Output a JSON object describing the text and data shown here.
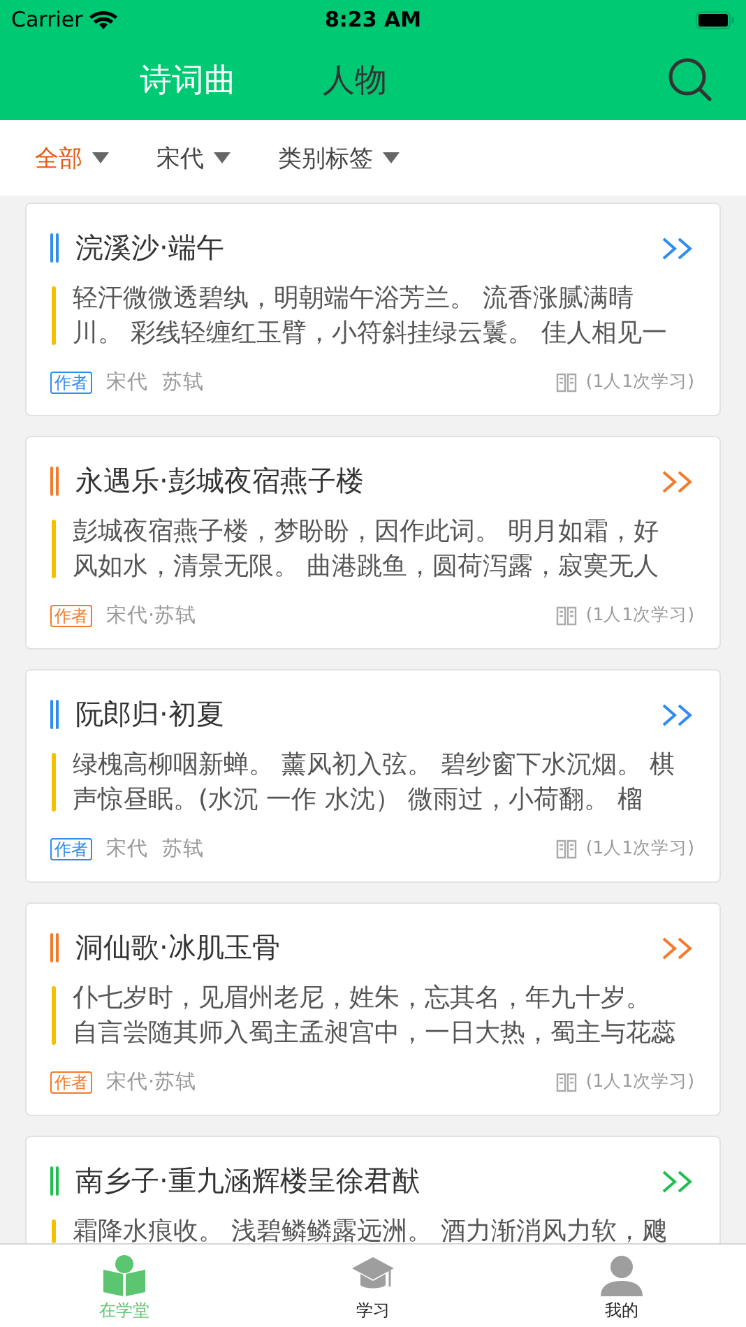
{
  "status_bar": {
    "carrier": "Carrier",
    "time": "8:23 AM"
  },
  "top_tabs": [
    {
      "label": "诗词曲",
      "selected": true
    },
    {
      "label": "人物",
      "selected": false
    }
  ],
  "filters": [
    {
      "label": "全部",
      "selected": true
    },
    {
      "label": "宋代",
      "selected": false
    },
    {
      "label": "类别标签",
      "selected": false
    }
  ],
  "cards": [
    {
      "title": "浣溪沙·端午",
      "color": "#2f8cf0",
      "lines": [
        "轻汗微微透碧纨，明朝端午浴芳兰。 流香涨腻满晴",
        "川。 彩线轻缠红玉臂，小符斜挂绿云鬟。 佳人相见一"
      ],
      "tag": "作者",
      "meta": [
        "宋代",
        "苏轼"
      ],
      "stats": "(1人1次学习)"
    },
    {
      "title": "永遇乐·彭城夜宿燕子楼",
      "color": "#f47a2a",
      "lines": [
        "彭城夜宿燕子楼，梦盼盼，因作此词。 明月如霜，好",
        "风如水，清景无限。 曲港跳鱼，圆荷泻露，寂寞无人"
      ],
      "tag": "作者",
      "meta": [
        "宋代·苏轼"
      ],
      "stats": "(1人1次学习)"
    },
    {
      "title": "阮郎归·初夏",
      "color": "#2f8cf0",
      "lines": [
        "绿槐高柳咽新蝉。 薰风初入弦。 碧纱窗下水沉烟。 棋",
        "声惊昼眠。(水沉 一作 水沈） 微雨过，小荷翻。 榴"
      ],
      "tag": "作者",
      "meta": [
        "宋代",
        "苏轼"
      ],
      "stats": "(1人1次学习)"
    },
    {
      "title": "洞仙歌·冰肌玉骨",
      "color": "#f47a2a",
      "lines": [
        "仆七岁时，见眉州老尼，姓朱，忘其名，年九十岁。",
        "自言尝随其师入蜀主孟昶宫中，一日大热，蜀主与花蕊"
      ],
      "tag": "作者",
      "meta": [
        "宋代·苏轼"
      ],
      "stats": "(1人1次学习)"
    },
    {
      "title": "南乡子·重九涵辉楼呈徐君猷",
      "color": "#1fbf4f",
      "lines": [
        "霜降水痕收。 浅碧鳞鳞露远洲。 酒力渐消风力软，飕"
      ]
    }
  ],
  "tab_bar": [
    {
      "label": "在学堂",
      "kind": "reader",
      "selected": true
    },
    {
      "label": "学习",
      "kind": "cap",
      "selected": false
    },
    {
      "label": "我的",
      "kind": "person",
      "selected": false
    }
  ]
}
